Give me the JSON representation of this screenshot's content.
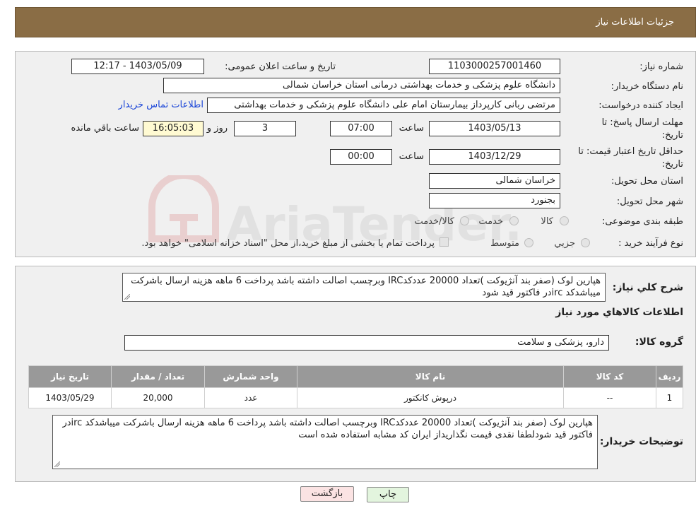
{
  "header": {
    "title": "جزئیات اطلاعات نیاز"
  },
  "form": {
    "need_number_label": "شماره نیاز:",
    "need_number": "1103000257001460",
    "announce_label": "تاریخ و ساعت اعلان عمومی:",
    "announce_value": "1403/05/09 - 12:17",
    "buyer_org_label": "نام دستگاه خریدار:",
    "buyer_org": "دانشگاه علوم پزشکی و خدمات بهداشتی درمانی استان خراسان شمالی",
    "creator_label": "ایجاد کننده درخواست:",
    "creator": "مرتضی ربانی کارپرداز بیمارستان امام علی دانشگاه علوم پزشکی و خدمات بهداشتی",
    "contact_link": "اطلاعات تماس خریدار",
    "deadline_label_1": "مهلت ارسال پاسخ: تا",
    "deadline_label_2": "تاریخ:",
    "deadline_date": "1403/05/13",
    "time_label": "ساعت",
    "deadline_time": "07:00",
    "days_value": "3",
    "days_label": "روز و",
    "remaining_time": "16:05:03",
    "remaining_label": "ساعت باقي مانده",
    "validity_label_1": "حداقل تاریخ اعتبار قیمت: تا",
    "validity_label_2": "تاریخ:",
    "validity_date": "1403/12/29",
    "validity_time": "00:00",
    "province_label": "استان محل تحویل:",
    "province": "خراسان شمالی",
    "city_label": "شهر محل تحویل:",
    "city": "بجنورد",
    "category_label": "طبقه بندی موضوعی:",
    "category_options": [
      "کالا",
      "خدمت",
      "کالا/خدمت"
    ],
    "process_label": "نوع فرآیند خرید :",
    "process_options": [
      "جزیي",
      "متوسط"
    ],
    "process_note": "پرداخت تمام یا بخشی از مبلغ خرید،از محل \"اسناد خزانه اسلامی\" خواهد بود."
  },
  "summary": {
    "label": "شرح كلي نياز:",
    "text": "هپارین لوک (صفر بند آنژیوکت )تعداد 20000 عددکدIRC وبرچسب اصالت داشته باشد پرداخت 6 ماهه هزینه ارسال باشرکت میباشدکد ircدر فاکتور قید شود",
    "items_title": "اطلاعات كالاهاي مورد نياز",
    "group_label": "گروه کالا:",
    "group_value": "دارو، پزشکی و سلامت"
  },
  "table": {
    "headers": [
      "رديف",
      "كد كالا",
      "نام كالا",
      "واحد شمارش",
      "تعداد / مقدار",
      "تاريخ نياز"
    ],
    "rows": [
      [
        "1",
        "--",
        "درپوش کانکتور",
        "عدد",
        "20,000",
        "1403/05/29"
      ]
    ]
  },
  "buyer_notes": {
    "label": "توضیحات خریدار:",
    "text": "هپارین لوک (صفر بند آنژیوکت )تعداد 20000 عددکدIRC وبرچسب اصالت داشته باشد پرداخت 6 ماهه هزینه ارسال باشرکت میباشدکد ircدر فاکتور قید شودلطفا نقدی قیمت نگذاریداز ایران کد مشابه استفاده شده است"
  },
  "buttons": {
    "print": "چاپ",
    "back": "بازگشت"
  },
  "colors": {
    "header_bg": "#8a6d45",
    "table_header_bg": "#999999",
    "link": "#1a45d8",
    "back_bg": "#fbe3e3",
    "print_bg": "#e3f5de"
  },
  "watermark": {
    "text": "AriaTender.neT"
  }
}
